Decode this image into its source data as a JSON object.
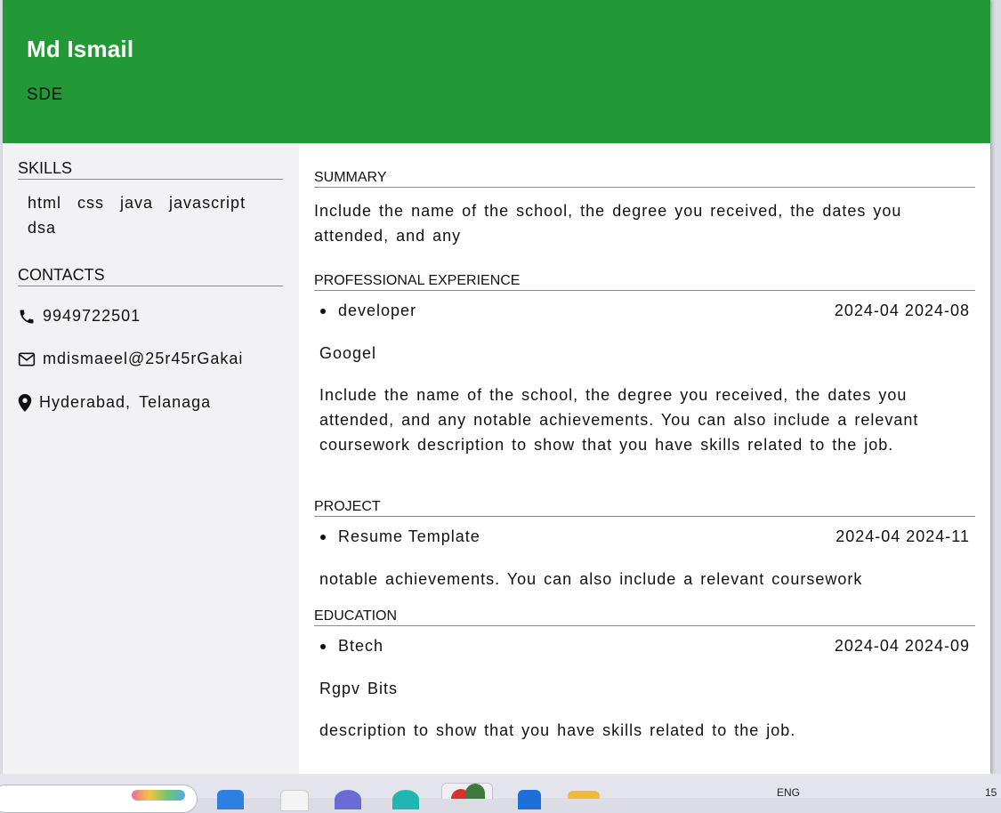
{
  "header": {
    "name": "Md Ismail",
    "title": "SDE"
  },
  "sidebar": {
    "skills_heading": "SKILLS",
    "skills": [
      "html",
      "css",
      "java",
      "javascript",
      "dsa"
    ],
    "contacts_heading": "CONTACTS",
    "contacts": {
      "phone": "9949722501",
      "email": "mdismaeel@25r45rGakai",
      "location_city": "Hyderabad,",
      "location_state": "Telanaga"
    }
  },
  "main": {
    "summary_heading": "SUMMARY",
    "summary_text": "Include the name of the school, the degree you received, the dates you attended, and any",
    "experience_heading": "PROFESSIONAL EXPERIENCE",
    "experience": {
      "role": "developer",
      "dates": "2024-04 2024-08",
      "company": "Googel",
      "description": "Include the name of the school, the degree you received, the dates you attended, and any notable achievements. You can also include a relevant coursework description to show that you have skills related to the job."
    },
    "project_heading": "PROJECT",
    "project": {
      "name": "Resume Template",
      "dates": "2024-04 2024-11",
      "description": "notable achievements. You can also include a relevant coursework"
    },
    "education_heading": "EDUCATION",
    "education": {
      "degree": "Btech",
      "dates": "2024-04 2024-09",
      "institution": "Rgpv Bits",
      "description": "description to show that you have skills related to the job."
    }
  },
  "taskbar": {
    "lang": "ENG",
    "clock": "15"
  },
  "colors": {
    "header_bg": "#229936",
    "sidebar_bg": "#f2f2f4"
  }
}
